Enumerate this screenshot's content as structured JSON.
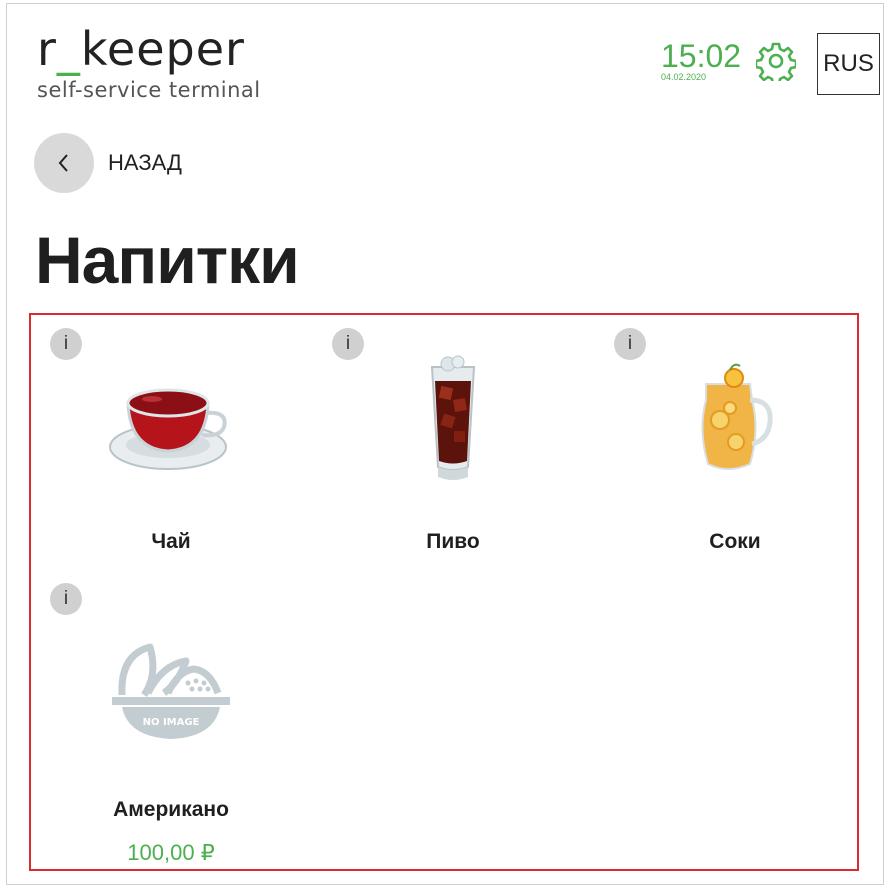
{
  "header": {
    "logo_main_left": "r",
    "logo_main_underscore": "_",
    "logo_main_right": "keeper",
    "logo_sub": "self-service terminal",
    "time": "15:02",
    "date": "04.02.2020",
    "settings_icon": "gear-icon",
    "language": "RUS"
  },
  "nav": {
    "back_label": "НАЗАД",
    "back_icon": "chevron-left-icon"
  },
  "page": {
    "title": "Напитки"
  },
  "colors": {
    "accent_green": "#4caf50",
    "grid_border": "#d92c2c"
  },
  "categories": [
    {
      "name": "Чай",
      "info": "i",
      "icon": "tea-cup-image"
    },
    {
      "name": "Пиво",
      "info": "i",
      "icon": "beer-glass-image"
    },
    {
      "name": "Соки",
      "info": "i",
      "icon": "juice-jug-image"
    },
    {
      "name": "Американо",
      "info": "i",
      "icon": "no-image-placeholder",
      "price": "100,00 ₽"
    }
  ]
}
